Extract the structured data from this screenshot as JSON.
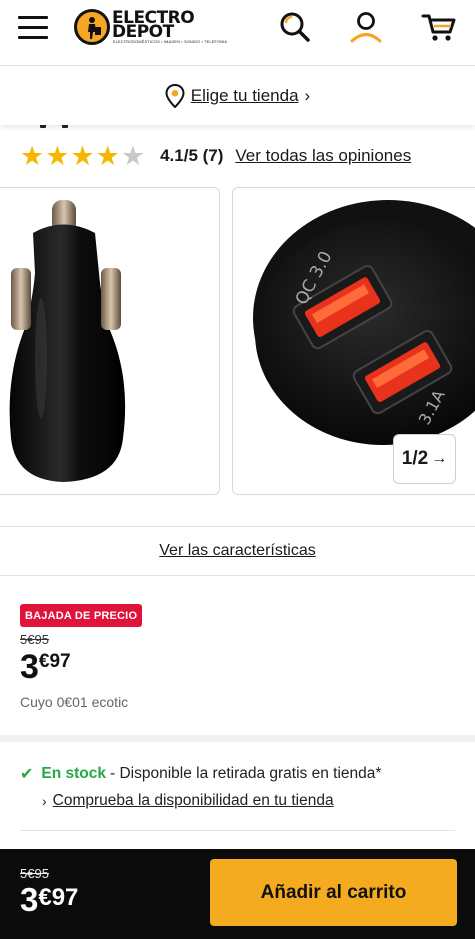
{
  "header": {
    "menu_icon": "hamburger-menu-icon",
    "logo_text_line1": "ELECTRO",
    "logo_text_line2": "DEPOT",
    "logo_tagline": "ELECTRODOMÉSTICOS • IMAGEN • SONIDO • TELEFONÍA",
    "search_icon": "search-icon",
    "account_icon": "user-icon",
    "cart_icon": "cart-icon"
  },
  "store_selector": {
    "icon": "map-pin-icon",
    "label": "Elige tu tienda",
    "chevron": "›"
  },
  "rating": {
    "stars_filled": 4,
    "stars_total": 5,
    "score_text": "4.1/5 (7)",
    "all_reviews_label": "Ver todas las opiniones",
    "star_color": "#f5b800",
    "star_empty_color": "#c8c8c8"
  },
  "gallery": {
    "counter_text": "1/2",
    "counter_arrow": "→",
    "images": [
      {
        "name": "car-charger-side-view"
      },
      {
        "name": "car-charger-front-view",
        "port1_label": "QC 3.0",
        "port2_label": "3.1A"
      }
    ]
  },
  "characteristics_link": "Ver las características",
  "pricing": {
    "badge": "BAJADA DE PRECIO",
    "old_price": "5€95",
    "price_units": "3",
    "price_cents": "€97",
    "ecotic_note": "Cuyo 0€01 ecotic",
    "badge_color": "#e0133b"
  },
  "availability": {
    "check_icon": "✔",
    "in_stock": "En stock",
    "description": "- Disponible la retirada gratis en tienda*",
    "check_store_chevron": "›",
    "check_store_link": "Comprueba la disponibilidad en tu tienda",
    "stock_color": "#28a745"
  },
  "sticky_bar": {
    "old_price": "5€95",
    "price_units": "3",
    "price_cents": "€97",
    "add_to_cart_label": "Añadir al carrito",
    "button_color": "#f5ab1f"
  }
}
